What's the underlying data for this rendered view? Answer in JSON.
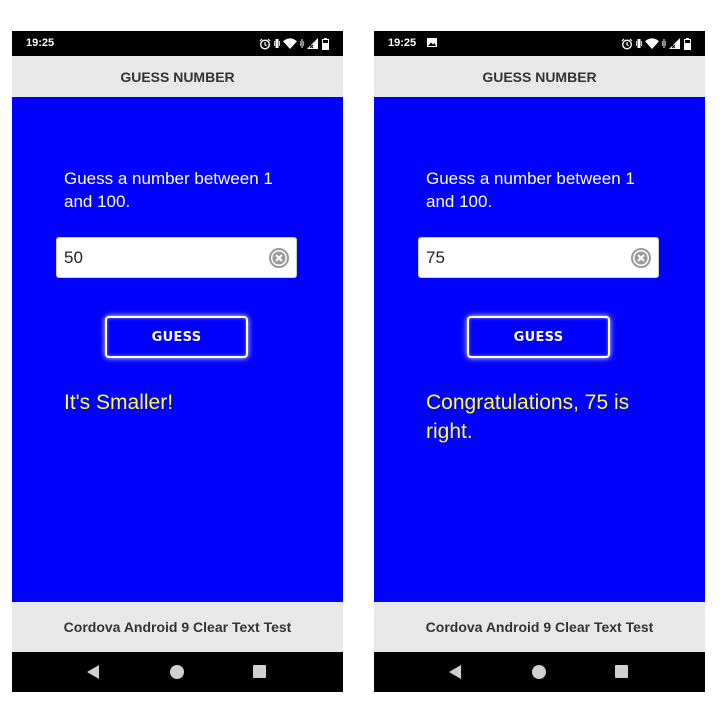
{
  "screens": [
    {
      "status_bar": {
        "time": "19:25",
        "show_image_icon": false
      },
      "header": {
        "title": "GUESS NUMBER"
      },
      "prompt": "Guess a number between 1 and 100.",
      "input": {
        "value": "50"
      },
      "guess_button": {
        "label": "GUESS"
      },
      "result": "It's Smaller!",
      "footer": {
        "text": "Cordova Android 9 Clear Text Test"
      }
    },
    {
      "status_bar": {
        "time": "19:25",
        "show_image_icon": true
      },
      "header": {
        "title": "GUESS NUMBER"
      },
      "prompt": "Guess a number between 1 and 100.",
      "input": {
        "value": "75"
      },
      "guess_button": {
        "label": "GUESS"
      },
      "result": "Congratulations, 75 is right.",
      "footer": {
        "text": "Cordova Android 9 Clear Text Test"
      }
    }
  ],
  "icons": {
    "status": [
      "alarm-icon",
      "vibrate-icon",
      "wifi-icon",
      "signal-icon",
      "battery-icon"
    ],
    "image_notification": "image-icon",
    "clear": "clear-icon",
    "nav": [
      "back-icon",
      "home-icon",
      "recents-icon"
    ]
  },
  "colors": {
    "content_background": "#0000ff",
    "bar_background": "#e8e8e8",
    "result_text": "#ffff33",
    "status_bar": "#000000"
  }
}
